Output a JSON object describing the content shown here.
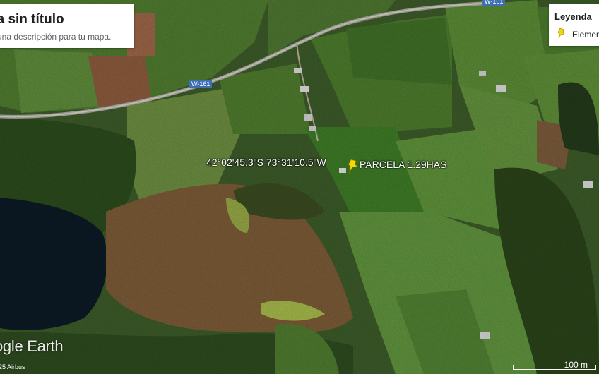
{
  "map": {
    "title": "pa sin título",
    "description": "e una descripción para tu mapa.",
    "legend": {
      "title": "Leyenda",
      "items": [
        {
          "label": "Elemen",
          "icon": "pushpin-icon",
          "color": "#f5d800"
        }
      ]
    },
    "road_labels": [
      "W-161",
      "W-161"
    ],
    "placemark": {
      "coordinates": "42°02'45.3\"S 73°31'10.5\"W",
      "label": "PARCELA 1.29HAS",
      "icon": "pushpin-icon",
      "color": "#f5d800"
    },
    "branding": "ogle Earth",
    "imagery_credit": "25 Airbus",
    "scale_bar": "100 m"
  }
}
